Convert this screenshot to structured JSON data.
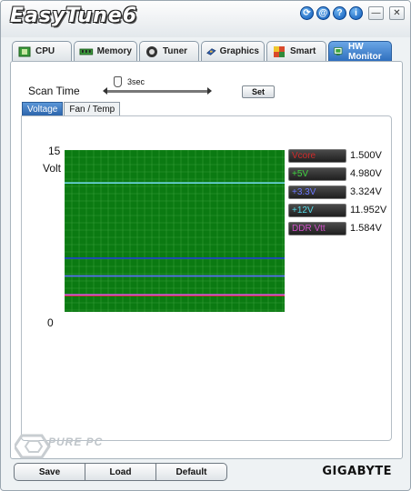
{
  "app": {
    "title": "EasyTune6"
  },
  "titlebar_icons": [
    {
      "name": "update",
      "glyph": "⟳"
    },
    {
      "name": "web",
      "glyph": "@"
    },
    {
      "name": "help",
      "glyph": "?"
    },
    {
      "name": "info",
      "glyph": "i"
    }
  ],
  "tabs": [
    {
      "label": "CPU",
      "icon": "cpu-chip-icon",
      "active": false
    },
    {
      "label": "Memory",
      "icon": "memory-module-icon",
      "active": false
    },
    {
      "label": "Tuner",
      "icon": "tuner-gauge-icon",
      "active": false
    },
    {
      "label": "Graphics",
      "icon": "graphics-card-icon",
      "active": false
    },
    {
      "label": "Smart",
      "icon": "smart-fan-icon",
      "active": false
    },
    {
      "label": "HW Monitor",
      "icon": "monitor-icon",
      "active": true
    }
  ],
  "scan": {
    "label": "Scan Time",
    "value": "3sec",
    "set_label": "Set",
    "level": 0.1
  },
  "subtabs": [
    {
      "label": "Voltage",
      "active": true
    },
    {
      "label": "Fan / Temp",
      "active": false
    }
  ],
  "graph": {
    "y_max": "15",
    "y_unit": "Volt",
    "y_min": "0",
    "background": "#0b7a12",
    "grid_color": "#4fb04f"
  },
  "chart_data": {
    "type": "line",
    "ylim": [
      0,
      15
    ],
    "series": [
      {
        "name": "Vcore",
        "value": 1.5,
        "color": "#c0392b"
      },
      {
        "name": "+5V",
        "value": 4.98,
        "color": "#1f3fd0"
      },
      {
        "name": "+3.3V",
        "value": 3.324,
        "color": "#5a6cff"
      },
      {
        "name": "+12V",
        "value": 11.952,
        "color": "#6fd6e6"
      },
      {
        "name": "DDR Vtt",
        "value": 1.584,
        "color": "#d94fd9"
      }
    ]
  },
  "readings": [
    {
      "label": "Vcore",
      "value": "1.500V",
      "color": "#d12a2a"
    },
    {
      "label": "+5V",
      "value": "4.980V",
      "color": "#3fd43f"
    },
    {
      "label": "+3.3V",
      "value": "3.324V",
      "color": "#6b78ff"
    },
    {
      "label": "+12V",
      "value": "11.952V",
      "color": "#54dbe8"
    },
    {
      "label": "DDR Vtt",
      "value": "1.584V",
      "color": "#d04fc8"
    }
  ],
  "buttons": {
    "save": "Save",
    "load": "Load",
    "default": "Default"
  },
  "brand": "GIGABYTE",
  "watermark": "PURE PC"
}
